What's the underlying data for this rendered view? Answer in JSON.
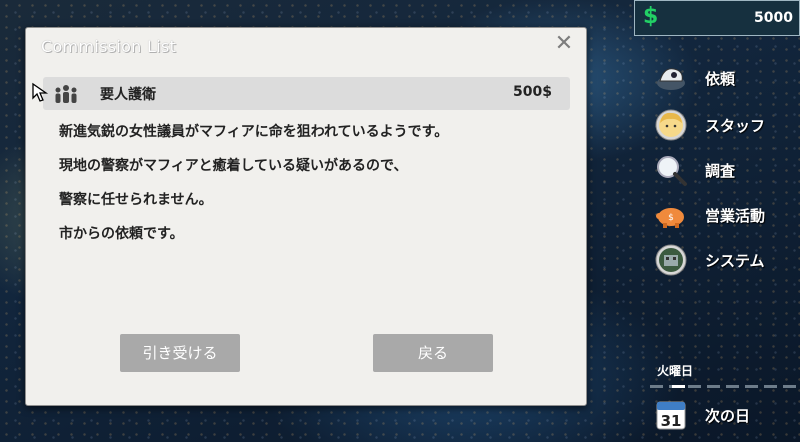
{
  "dialog": {
    "title": "Commission List",
    "commission": {
      "name": "要人護衛",
      "price": "500$"
    },
    "description": [
      "新進気鋭の女性議員がマフィアに命を狙われているようです。",
      "現地の警察がマフィアと癒着している疑いがあるので、",
      "警察に任せられません。",
      "市からの依頼です。"
    ],
    "buttons": {
      "accept": "引き受ける",
      "back": "戻る"
    }
  },
  "hud": {
    "money_symbol": "$",
    "money": "5000",
    "money_color": "#22d065"
  },
  "menu": {
    "items": [
      {
        "label": "依頼",
        "icon": "commission-icon"
      },
      {
        "label": "スタッフ",
        "icon": "staff-avatar-icon"
      },
      {
        "label": "調査",
        "icon": "magnifier-icon"
      },
      {
        "label": "営業活動",
        "icon": "piggy-bank-icon"
      },
      {
        "label": "システム",
        "icon": "system-icon"
      }
    ],
    "weekday": "火曜日",
    "next_day": "次の日",
    "calendar_day": "31"
  }
}
